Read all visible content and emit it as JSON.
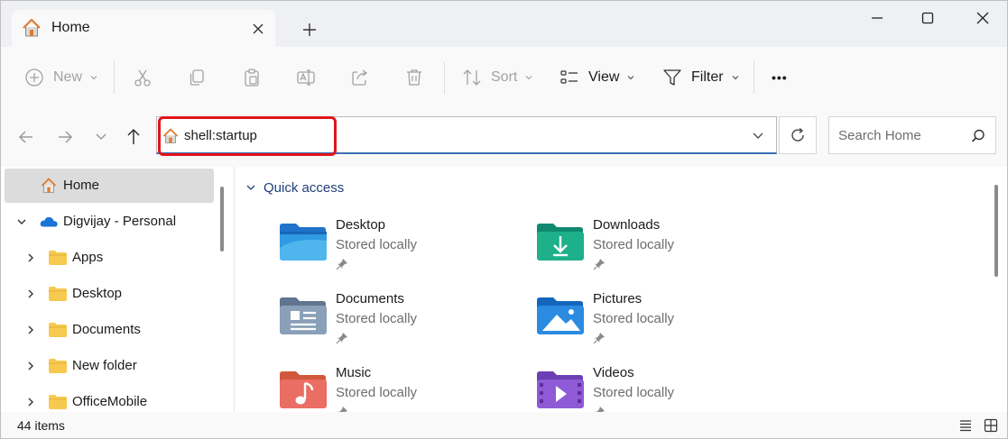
{
  "window": {
    "tab_title": "Home",
    "icons": {
      "tab": "home-icon",
      "close": "close-icon",
      "new_tab": "plus-icon",
      "minimize": "minimize-icon",
      "maximize": "maximize-icon",
      "close_window": "close-icon"
    }
  },
  "toolbar": {
    "new_label": "New",
    "sort_label": "Sort",
    "view_label": "View",
    "filter_label": "Filter",
    "more_label": "•••"
  },
  "address": {
    "path": "shell:startup",
    "search_placeholder": "Search Home"
  },
  "sidebar": {
    "items": [
      {
        "label": "Home"
      },
      {
        "label": "Digvijay - Personal"
      },
      {
        "label": "Apps"
      },
      {
        "label": "Desktop"
      },
      {
        "label": "Documents"
      },
      {
        "label": "New folder"
      },
      {
        "label": "OfficeMobile"
      }
    ]
  },
  "main": {
    "section_title": "Quick access",
    "tiles": [
      {
        "name": "Desktop",
        "sub": "Stored locally"
      },
      {
        "name": "Downloads",
        "sub": "Stored locally"
      },
      {
        "name": "Documents",
        "sub": "Stored locally"
      },
      {
        "name": "Pictures",
        "sub": "Stored locally"
      },
      {
        "name": "Music",
        "sub": "Stored locally"
      },
      {
        "name": "Videos",
        "sub": "Stored locally"
      }
    ]
  },
  "status": {
    "count": "44 items"
  },
  "colors": {
    "accent": "#3a6fb8",
    "highlight": "#e0151a",
    "folder": "#f6c94f",
    "quick_access": "#1f3f7a"
  }
}
